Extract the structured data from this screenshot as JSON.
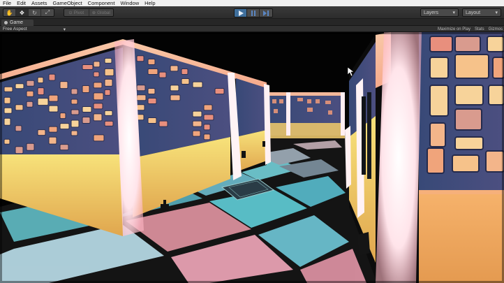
{
  "menu": [
    "File",
    "Edit",
    "Assets",
    "GameObject",
    "Component",
    "Window",
    "Help"
  ],
  "toolbar": {
    "transform_tools": [
      "hand-tool",
      "move-tool",
      "rotate-tool",
      "scale-tool"
    ],
    "pivot_label": "Pivot",
    "global_label": "Global",
    "play_state": "playing",
    "layers_label": "Layers",
    "layout_label": "Layout"
  },
  "game_tab": {
    "label": "Game"
  },
  "game_controls": {
    "aspect_label": "Free Aspect",
    "maximize_label": "Maximize on Play",
    "stats_label": "Stats",
    "gizmos_label": "Gizmos"
  },
  "colors": {
    "menubar_bg": "#f0f0f0",
    "toolbar_bg": "#2f2f2f",
    "play_active": "#3f6f9c",
    "wall_panel_blue": "#3b4a78",
    "wall_yellow": "#e8c55a",
    "pillar_glow": "#fff0f0",
    "floor_teal": "#4a9aa8",
    "floor_pink": "#d08a96"
  }
}
